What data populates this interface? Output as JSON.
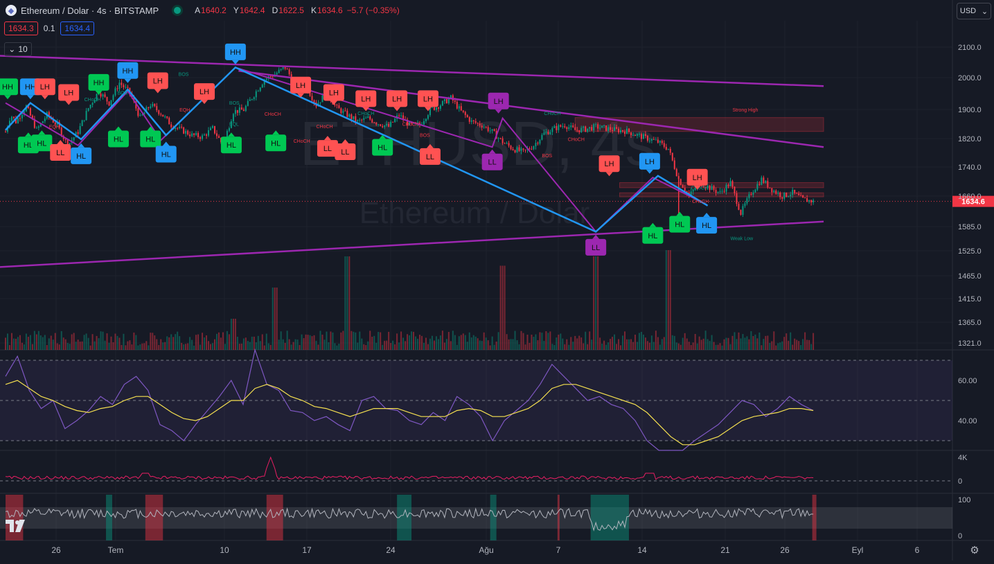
{
  "header": {
    "title": "Ethereum / Dolar · 4s · BITSTAMP",
    "open_label": "A",
    "open": "1640.2",
    "high_label": "Y",
    "high": "1642.4",
    "low_label": "D",
    "low": "1622.5",
    "close_label": "K",
    "close": "1634.6",
    "change": "−5.7 (−0.35%)"
  },
  "trade": {
    "sell": "1634.3",
    "spread": "0.1",
    "buy": "1634.4"
  },
  "indicators_count": "10",
  "currency": "USD",
  "watermark": {
    "line1": "ETHUSD, 4s",
    "line2": "Ethereum / Dolar"
  },
  "colors": {
    "background": "#161a25",
    "grid": "#1e222d",
    "text": "#b2b5be",
    "bull": "#089981",
    "bear": "#f23645",
    "purple": "#9c27b0",
    "blue": "#2196f3",
    "green_label": "#00c853",
    "red_label": "#ff5252",
    "rsi": "#7e57c2",
    "rsi_ma": "#f5e050",
    "obv": "#e91e63"
  },
  "chart_data": {
    "type": "candlestick",
    "symbol": "ETHUSD",
    "interval": "4s",
    "exchange": "BITSTAMP",
    "current_price": 1634.6,
    "price_axis": {
      "ticks": [
        2100.0,
        2000.0,
        1900.0,
        1820.0,
        1740.0,
        1660.0,
        1585.0,
        1525.0,
        1465.0,
        1415.0,
        1365.0,
        1321.0
      ]
    },
    "x_axis": {
      "ticks": [
        "26",
        "Tem",
        "10",
        "17",
        "24",
        "Ağu",
        "7",
        "14",
        "21",
        "26",
        "Eyl",
        "6"
      ]
    },
    "price_path": [
      [
        0,
        1840
      ],
      [
        0.5,
        1890
      ],
      [
        1,
        1870
      ],
      [
        2,
        1915
      ],
      [
        3,
        1845
      ],
      [
        4,
        1890
      ],
      [
        5,
        1860
      ],
      [
        6,
        1800
      ],
      [
        7,
        1840
      ],
      [
        8,
        1910
      ],
      [
        9,
        1960
      ],
      [
        10,
        1925
      ],
      [
        11,
        1985
      ],
      [
        12,
        1955
      ],
      [
        13,
        1880
      ],
      [
        14,
        1920
      ],
      [
        15,
        1895
      ],
      [
        16,
        1860
      ],
      [
        17,
        1845
      ],
      [
        18,
        1830
      ],
      [
        19,
        1825
      ],
      [
        20,
        1850
      ],
      [
        21,
        1800
      ],
      [
        22,
        1900
      ],
      [
        23,
        1905
      ],
      [
        24,
        1950
      ],
      [
        25,
        1995
      ],
      [
        26,
        2010
      ],
      [
        27,
        2030
      ],
      [
        28,
        1980
      ],
      [
        29,
        1975
      ],
      [
        30,
        1920
      ],
      [
        31,
        1955
      ],
      [
        32,
        1910
      ],
      [
        33,
        1890
      ],
      [
        34,
        1870
      ],
      [
        35,
        1880
      ],
      [
        36,
        1865
      ],
      [
        37,
        1855
      ],
      [
        38,
        1890
      ],
      [
        39,
        1860
      ],
      [
        40,
        1860
      ],
      [
        41,
        1905
      ],
      [
        42,
        1920
      ],
      [
        43,
        1940
      ],
      [
        44,
        1900
      ],
      [
        45,
        1870
      ],
      [
        46,
        1860
      ],
      [
        47,
        1840
      ],
      [
        48,
        1810
      ],
      [
        49,
        1790
      ],
      [
        50,
        1780
      ],
      [
        51,
        1800
      ],
      [
        52,
        1835
      ],
      [
        53,
        1850
      ],
      [
        54,
        1860
      ],
      [
        55,
        1845
      ],
      [
        56,
        1848
      ],
      [
        57,
        1855
      ],
      [
        58,
        1850
      ],
      [
        59,
        1845
      ],
      [
        60,
        1842
      ],
      [
        61,
        1830
      ],
      [
        62,
        1820
      ],
      [
        63,
        1810
      ],
      [
        64,
        1790
      ],
      [
        65,
        1700
      ],
      [
        66,
        1650
      ],
      [
        67,
        1690
      ],
      [
        68,
        1675
      ],
      [
        69,
        1660
      ],
      [
        70,
        1690
      ],
      [
        71,
        1600
      ],
      [
        72,
        1660
      ],
      [
        73,
        1700
      ],
      [
        74,
        1670
      ],
      [
        75,
        1650
      ],
      [
        76,
        1660
      ],
      [
        77,
        1640
      ],
      [
        78,
        1634.6
      ]
    ],
    "extremes": [
      {
        "i": 65,
        "low": 1545
      }
    ],
    "last_index": 78,
    "labels": [
      {
        "i": 0.2,
        "p": 1932,
        "t": "HH",
        "c": "green",
        "pos": "up"
      },
      {
        "i": 2.4,
        "p": 1932,
        "t": "HH",
        "c": "blue",
        "pos": "up"
      },
      {
        "i": 3.8,
        "p": 1932,
        "t": "LH",
        "c": "red",
        "pos": "up"
      },
      {
        "i": 6.1,
        "p": 1915,
        "t": "LH",
        "c": "red",
        "pos": "up"
      },
      {
        "i": 9.0,
        "p": 1945,
        "t": "HH",
        "c": "green",
        "pos": "up"
      },
      {
        "i": 11.8,
        "p": 1980,
        "t": "HH",
        "c": "blue",
        "pos": "up"
      },
      {
        "i": 14.7,
        "p": 1950,
        "t": "LH",
        "c": "red",
        "pos": "up"
      },
      {
        "i": 19.2,
        "p": 1918,
        "t": "LH",
        "c": "red",
        "pos": "up"
      },
      {
        "i": 22.2,
        "p": 2035,
        "t": "HH",
        "c": "blue",
        "pos": "up"
      },
      {
        "i": 28.5,
        "p": 1937,
        "t": "LH",
        "c": "red",
        "pos": "up"
      },
      {
        "i": 31.7,
        "p": 1915,
        "t": "LH",
        "c": "red",
        "pos": "up"
      },
      {
        "i": 34.8,
        "p": 1897,
        "t": "LH",
        "c": "red",
        "pos": "up"
      },
      {
        "i": 37.8,
        "p": 1897,
        "t": "LH",
        "c": "red",
        "pos": "up"
      },
      {
        "i": 40.8,
        "p": 1897,
        "t": "LH",
        "c": "red",
        "pos": "up"
      },
      {
        "i": 47.6,
        "p": 1890,
        "t": "LH",
        "c": "purple",
        "pos": "up"
      },
      {
        "i": 58.3,
        "p": 1705,
        "t": "LH",
        "c": "red",
        "pos": "up"
      },
      {
        "i": 62.2,
        "p": 1712,
        "t": "LH",
        "c": "blue",
        "pos": "up"
      },
      {
        "i": 66.8,
        "p": 1665,
        "t": "LH",
        "c": "red",
        "pos": "up"
      },
      {
        "i": 2.2,
        "p": 1842,
        "t": "HL",
        "c": "green",
        "pos": "down"
      },
      {
        "i": 3.5,
        "p": 1848,
        "t": "HL",
        "c": "green",
        "pos": "down"
      },
      {
        "i": 5.3,
        "p": 1820,
        "t": "LL",
        "c": "red",
        "pos": "down"
      },
      {
        "i": 7.3,
        "p": 1810,
        "t": "HL",
        "c": "blue",
        "pos": "down"
      },
      {
        "i": 10.9,
        "p": 1860,
        "t": "HL",
        "c": "green",
        "pos": "down"
      },
      {
        "i": 14.0,
        "p": 1860,
        "t": "HL",
        "c": "green",
        "pos": "down"
      },
      {
        "i": 15.5,
        "p": 1815,
        "t": "HL",
        "c": "blue",
        "pos": "down"
      },
      {
        "i": 21.8,
        "p": 1842,
        "t": "HL",
        "c": "green",
        "pos": "down"
      },
      {
        "i": 26.1,
        "p": 1848,
        "t": "HL",
        "c": "green",
        "pos": "down"
      },
      {
        "i": 31.1,
        "p": 1832,
        "t": "LL",
        "c": "red",
        "pos": "down"
      },
      {
        "i": 32.8,
        "p": 1822,
        "t": "LL",
        "c": "red",
        "pos": "down"
      },
      {
        "i": 36.4,
        "p": 1835,
        "t": "HL",
        "c": "green",
        "pos": "down"
      },
      {
        "i": 41.0,
        "p": 1808,
        "t": "LL",
        "c": "red",
        "pos": "down"
      },
      {
        "i": 47.0,
        "p": 1792,
        "t": "LL",
        "c": "purple",
        "pos": "down"
      },
      {
        "i": 57.0,
        "p": 1540,
        "t": "LL",
        "c": "purple",
        "pos": "down"
      },
      {
        "i": 62.5,
        "p": 1575,
        "t": "HL",
        "c": "green",
        "pos": "down"
      },
      {
        "i": 65.1,
        "p": 1608,
        "t": "HL",
        "c": "green",
        "pos": "down"
      },
      {
        "i": 67.7,
        "p": 1605,
        "t": "HL",
        "c": "blue",
        "pos": "down"
      }
    ],
    "trendlines": [
      {
        "p1": [
          -1,
          2065
        ],
        "p2": [
          79,
          1975
        ],
        "color": "purple",
        "width": 2.5
      },
      {
        "p1": [
          22.5,
          2020
        ],
        "p2": [
          79,
          1795
        ],
        "color": "purple",
        "width": 2.5
      },
      {
        "p1": [
          -1,
          1440
        ],
        "p2": [
          79,
          1575
        ],
        "color": "purple",
        "width": 2.5
      }
    ],
    "zigzag_purple": [
      [
        0,
        1925
      ],
      [
        7,
        1800
      ],
      [
        11.8,
        1960
      ],
      [
        15,
        1815
      ],
      [
        22.2,
        2030
      ],
      [
        47,
        1795
      ],
      [
        48,
        1880
      ],
      [
        57,
        1545
      ],
      [
        62.5,
        1705
      ],
      [
        67.7,
        1625
      ]
    ],
    "zigzag_blue": [
      [
        0,
        1845
      ],
      [
        2.4,
        1925
      ],
      [
        7.3,
        1818
      ],
      [
        11.8,
        1965
      ],
      [
        15.5,
        1830
      ],
      [
        22.2,
        2030
      ],
      [
        57,
        1545
      ],
      [
        63,
        1710
      ],
      [
        67.8,
        1622
      ]
    ],
    "annotations": [
      {
        "i": 16.7,
        "p": 2005,
        "t": "BOS",
        "c": "green"
      },
      {
        "i": 7.6,
        "p": 1930,
        "t": "CHoCH",
        "c": "green"
      },
      {
        "i": 10.8,
        "p": 1950,
        "t": "BOS",
        "c": "green"
      },
      {
        "i": 4.2,
        "p": 1850,
        "t": "EQH",
        "c": "red"
      },
      {
        "i": 16.8,
        "p": 1900,
        "t": "EQH",
        "c": "red"
      },
      {
        "i": 21.6,
        "p": 1920,
        "t": "BOS",
        "c": "green"
      },
      {
        "i": 21.6,
        "p": 1858,
        "t": "EQL",
        "c": "green"
      },
      {
        "i": 25.0,
        "p": 1887,
        "t": "CHoCH",
        "c": "red"
      },
      {
        "i": 27.8,
        "p": 1808,
        "t": "CHoCH",
        "c": "red"
      },
      {
        "i": 30.0,
        "p": 1851,
        "t": "CHoCH",
        "c": "red"
      },
      {
        "i": 34.0,
        "p": 1890,
        "t": "CHoCH",
        "c": "green"
      },
      {
        "i": 38.3,
        "p": 1858,
        "t": "CHoCH",
        "c": "red"
      },
      {
        "i": 40.0,
        "p": 1825,
        "t": "BOS",
        "c": "red"
      },
      {
        "i": 52.0,
        "p": 1890,
        "t": "CHoCH",
        "c": "green"
      },
      {
        "i": 54.3,
        "p": 1813,
        "t": "CHoCH",
        "c": "red"
      },
      {
        "i": 51.8,
        "p": 1765,
        "t": "BOS",
        "c": "red"
      },
      {
        "i": 70.2,
        "p": 1900,
        "t": "Strong High",
        "c": "red"
      },
      {
        "i": 70.0,
        "p": 1520,
        "t": "Weak Low",
        "c": "green"
      },
      {
        "i": 66.2,
        "p": 1670,
        "t": "CHoCH",
        "c": "green"
      },
      {
        "i": 66.3,
        "p": 1630,
        "t": "CHoCH",
        "c": "red"
      }
    ],
    "zones": [
      {
        "i1": 55,
        "i2": 79,
        "p1": 1882,
        "p2": 1841,
        "color": "red"
      },
      {
        "i1": 59.3,
        "i2": 79,
        "p1": 1690,
        "p2": 1675,
        "color": "red"
      },
      {
        "i1": 59.3,
        "i2": 79,
        "p1": 1660,
        "p2": 1648,
        "color": "red"
      }
    ],
    "volume": {
      "spikes": [
        [
          22,
          1450
        ],
        [
          57,
          1350
        ],
        [
          48,
          1365
        ],
        [
          26,
          1400
        ],
        [
          64,
          1340
        ],
        [
          33,
          1350
        ]
      ]
    },
    "rsi": {
      "ticks": [
        60.0,
        40.0
      ],
      "upper": 70,
      "lower": 30,
      "mid": 50,
      "values": [
        62,
        72,
        55,
        46,
        50,
        36,
        40,
        45,
        52,
        48,
        58,
        62,
        55,
        38,
        35,
        30,
        38,
        45,
        52,
        60,
        48,
        76,
        58,
        55,
        45,
        44,
        40,
        42,
        38,
        35,
        50,
        52,
        46,
        45,
        40,
        38,
        44,
        40,
        52,
        48,
        42,
        30,
        40,
        45,
        50,
        58,
        68,
        62,
        56,
        50,
        52,
        48,
        46,
        40,
        30,
        24,
        20,
        25,
        30,
        34,
        38,
        44,
        50,
        48,
        42,
        46,
        52,
        48,
        45
      ],
      "ma": [
        58,
        60,
        56,
        52,
        50,
        47,
        45,
        44,
        46,
        47,
        50,
        52,
        52,
        48,
        44,
        41,
        40,
        42,
        46,
        50,
        50,
        56,
        58,
        56,
        52,
        50,
        47,
        46,
        44,
        42,
        44,
        46,
        46,
        46,
        44,
        42,
        42,
        42,
        45,
        46,
        45,
        42,
        42,
        44,
        46,
        50,
        56,
        58,
        58,
        56,
        54,
        52,
        50,
        48,
        44,
        38,
        32,
        28,
        28,
        30,
        32,
        36,
        40,
        42,
        43,
        44,
        46,
        46,
        45
      ]
    },
    "obv": {
      "ticks": [
        "4K",
        "0"
      ]
    },
    "adx": {
      "ticks": [
        100,
        0
      ]
    }
  }
}
